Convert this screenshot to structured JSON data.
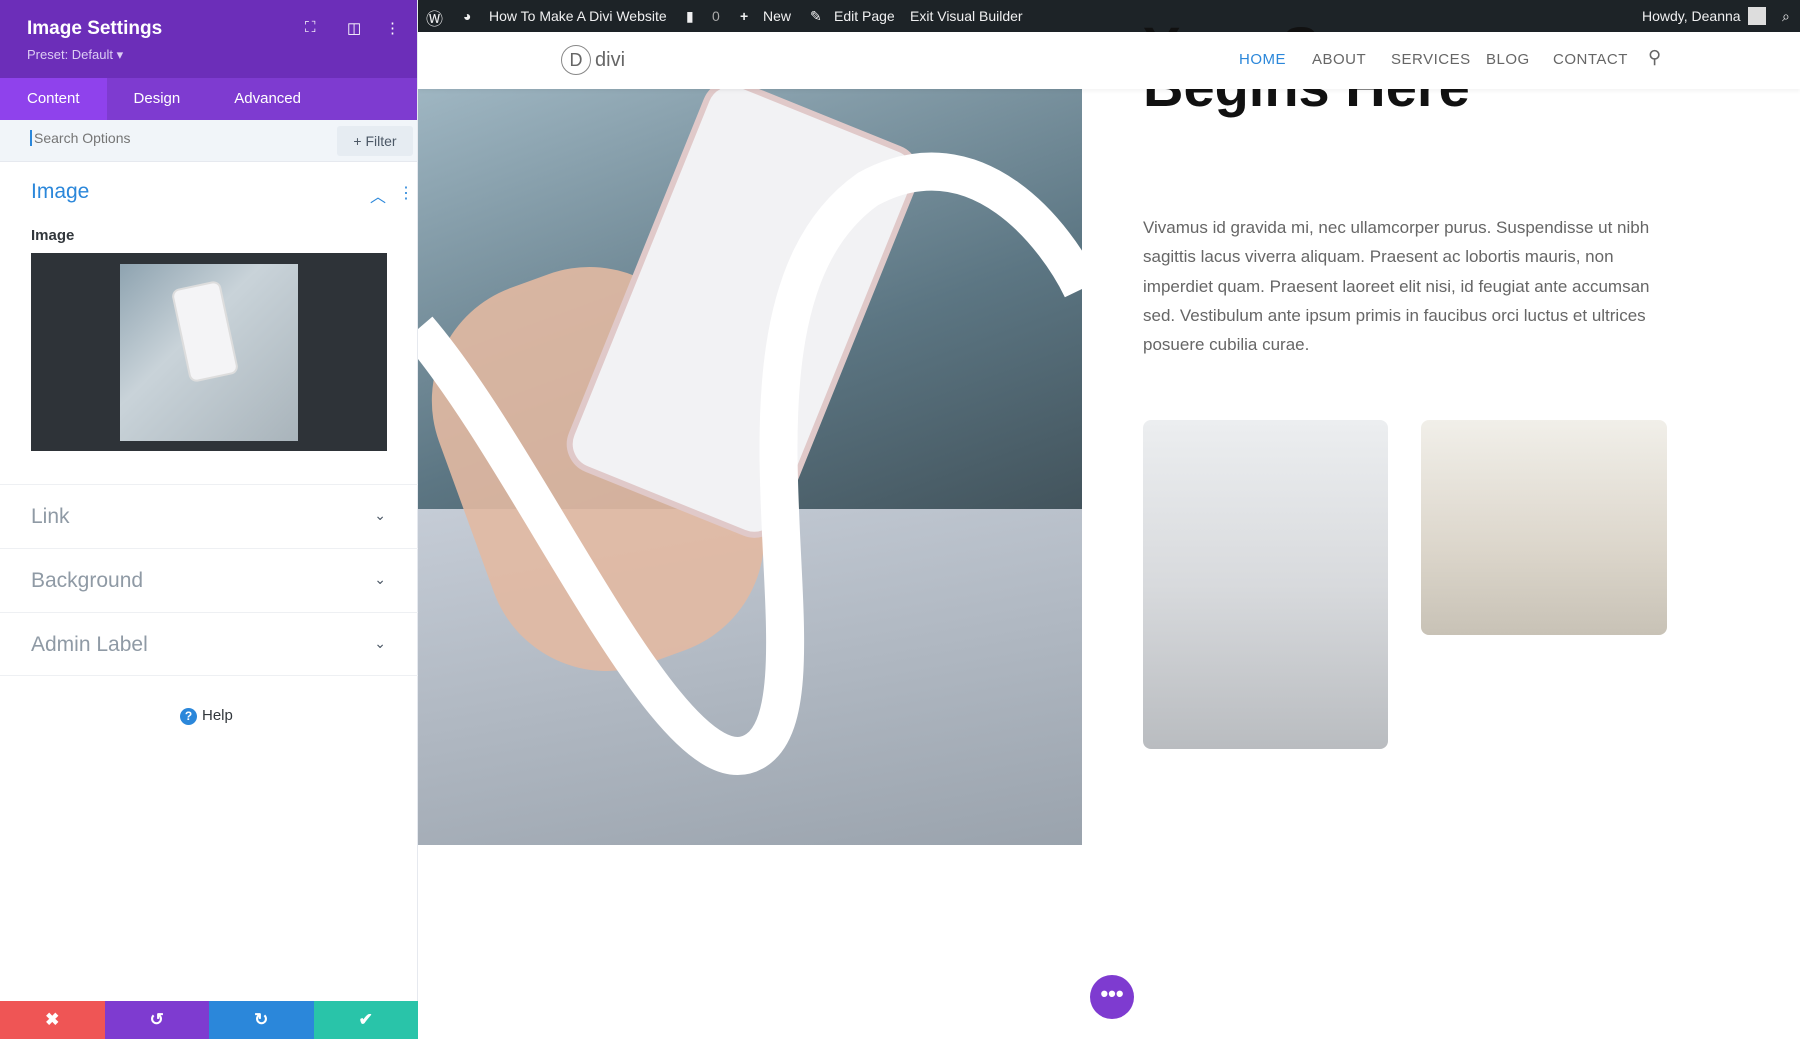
{
  "panel": {
    "title": "Image Settings",
    "preset": "Preset: Default ▾",
    "tabs": [
      "Content",
      "Design",
      "Advanced"
    ],
    "search_placeholder": "Search Options",
    "filter_label": "+ Filter",
    "section_title": "Image",
    "image_label": "Image",
    "toggles": [
      "Link",
      "Background",
      "Admin Label"
    ],
    "help": "Help",
    "colors": {
      "header": "#6c2eb9",
      "tabs": "#7e3bd0",
      "cancel": "#ef5555",
      "undo": "#7e3bd0",
      "redo": "#2b87da",
      "save": "#29c4a9"
    }
  },
  "adminbar": {
    "site": "How To Make A Divi Website",
    "comments": "0",
    "new": "New",
    "edit": "Edit Page",
    "exit": "Exit Visual Builder",
    "howdy": "Howdy, Deanna"
  },
  "nav": {
    "logo": "divi",
    "logo_letter": "D",
    "items": [
      "HOME",
      "ABOUT",
      "SERVICES",
      "BLOG",
      "CONTACT"
    ],
    "active_color": "#2b87da"
  },
  "content": {
    "title_top": "Your Success",
    "title": "Begins Here",
    "paragraph": "Vivamus id gravida mi, nec ullamcorper purus. Suspendisse ut nibh sagittis lacus viverra aliquam. Praesent ac lobortis mauris, non imperdiet quam. Praesent laoreet elit nisi, id feugiat ante accumsan sed. Vestibulum ante ipsum primis in faucibus orci luctus et ultrices posuere cubilia curae."
  }
}
